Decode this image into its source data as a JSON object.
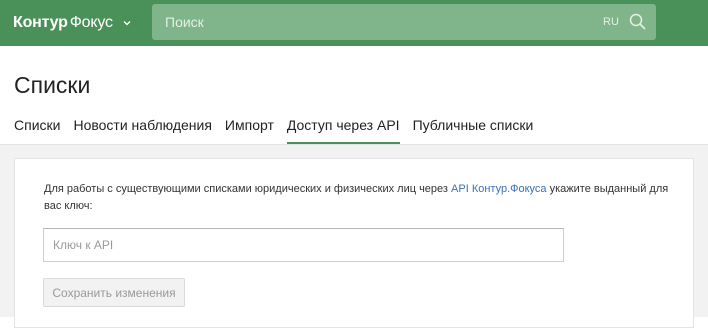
{
  "header": {
    "logo_part1": "Контур",
    "logo_part2": "Фокус",
    "logo_chevron": "chevron-down-icon",
    "search_placeholder": "Поиск",
    "search_value": "",
    "lang": "RU",
    "search_icon": "search-icon"
  },
  "page": {
    "title": "Списки"
  },
  "tabs": [
    {
      "label": "Списки",
      "active": false
    },
    {
      "label": "Новости наблюдения",
      "active": false
    },
    {
      "label": "Импорт",
      "active": false
    },
    {
      "label": "Доступ через API",
      "active": true
    },
    {
      "label": "Публичные списки",
      "active": false
    }
  ],
  "api_card": {
    "description_before": "Для работы с существующими списками юридических и физических лиц через ",
    "description_link": "API Контур.Фокуса",
    "description_after": " укажите выданный для вас ключ:",
    "input_placeholder": "Ключ к API",
    "input_value": "",
    "save_label": "Сохранить изменения",
    "save_disabled": true
  },
  "colors": {
    "header_bg": "#4a9159",
    "search_bg": "#80b58b",
    "link": "#3b72b4",
    "tab_active_underline": "#4a9159",
    "page_bg": "#f2f2f2"
  }
}
